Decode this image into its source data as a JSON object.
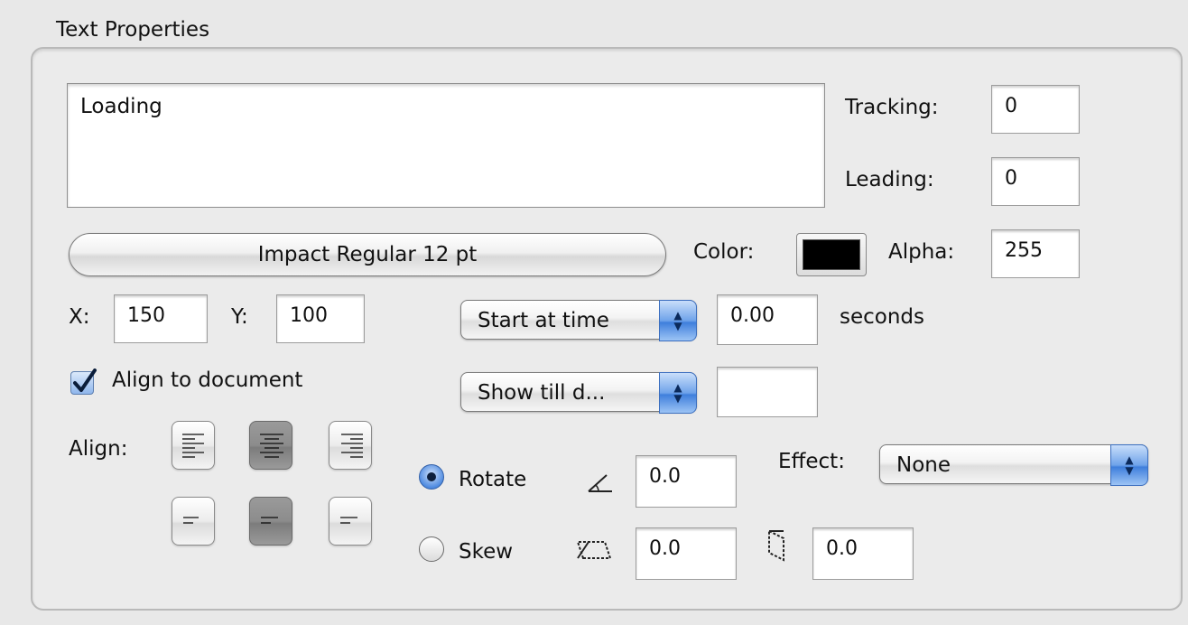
{
  "group": {
    "title": "Text Properties"
  },
  "text_content": "Loading",
  "tracking": {
    "label": "Tracking:",
    "value": "0"
  },
  "leading": {
    "label": "Leading:",
    "value": "0"
  },
  "font": {
    "label": "Impact Regular 12 pt"
  },
  "color": {
    "label": "Color:",
    "swatch": "#000000"
  },
  "alpha": {
    "label": "Alpha:",
    "value": "255"
  },
  "position": {
    "x_label": "X:",
    "x_value": "150",
    "y_label": "Y:",
    "y_value": "100"
  },
  "timing": {
    "start_option": "Start at time",
    "start_value": "0.00",
    "start_unit": "seconds",
    "end_option": "Show till d...",
    "end_value": ""
  },
  "align_to_document": {
    "label": "Align to document",
    "checked": true
  },
  "align": {
    "label": "Align:",
    "horizontal": [
      {
        "name": "left",
        "pressed": false
      },
      {
        "name": "center",
        "pressed": true
      },
      {
        "name": "right",
        "pressed": false
      }
    ],
    "vertical": [
      {
        "name": "top",
        "pressed": false
      },
      {
        "name": "middle",
        "pressed": true
      },
      {
        "name": "bottom",
        "pressed": false
      }
    ]
  },
  "transform": {
    "rotate_label": "Rotate",
    "rotate_selected": true,
    "rotate_value": "0.0",
    "skew_label": "Skew",
    "skew_selected": false,
    "skew_x_value": "0.0",
    "skew_y_value": "0.0"
  },
  "effect": {
    "label": "Effect:",
    "value": "None"
  },
  "icons": {
    "rotate": "angle-icon",
    "skew_x": "skew-horizontal-icon",
    "skew_y": "skew-vertical-icon",
    "popup": "up-down-arrows-icon",
    "check": "checkmark-icon"
  }
}
